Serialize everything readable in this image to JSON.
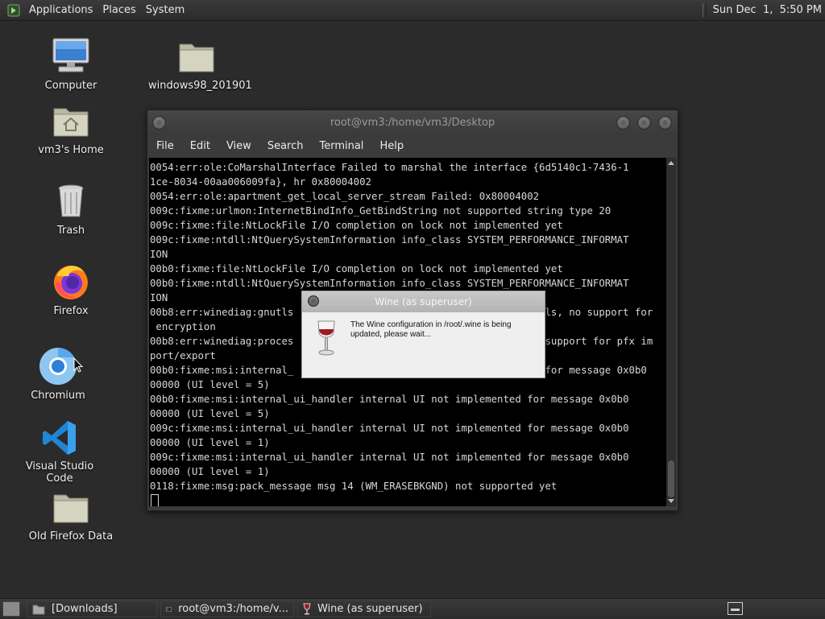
{
  "top_panel": {
    "menus": [
      "Applications",
      "Places",
      "System"
    ],
    "clock": "Sun Dec  1,  5:50 PM"
  },
  "desktop": {
    "icons": [
      {
        "label": "Computer",
        "icon": "computer-icon"
      },
      {
        "label": "windows98_201901",
        "icon": "folder-icon"
      },
      {
        "label": "vm3's Home",
        "icon": "home-folder-icon"
      },
      {
        "label": "Trash",
        "icon": "trash-icon"
      },
      {
        "label": "Firefox",
        "icon": "firefox-icon"
      },
      {
        "label": "Chromium",
        "icon": "chromium-icon"
      },
      {
        "label": "Visual Studio Code",
        "icon": "vscode-icon"
      },
      {
        "label": "Old Firefox Data",
        "icon": "folder-icon"
      }
    ]
  },
  "terminal": {
    "title": "root@vm3:/home/vm3/Desktop",
    "menu": [
      "File",
      "Edit",
      "View",
      "Search",
      "Terminal",
      "Help"
    ],
    "lines": [
      "0054:err:ole:CoMarshalInterface Failed to marshal the interface {6d5140c1-7436-1",
      "1ce-8034-00aa006009fa}, hr 0x80004002",
      "0054:err:ole:apartment_get_local_server_stream Failed: 0x80004002",
      "009c:fixme:urlmon:InternetBindInfo_GetBindString not supported string type 20",
      "009c:fixme:file:NtLockFile I/O completion on lock not implemented yet",
      "009c:fixme:ntdll:NtQuerySystemInformation info_class SYSTEM_PERFORMANCE_INFORMAT",
      "ION",
      "00b0:fixme:file:NtLockFile I/O completion on lock not implemented yet",
      "00b0:fixme:ntdll:NtQuerySystemInformation info_class SYSTEM_PERFORMANCE_INFORMAT",
      "ION",
      "00b8:err:winediag:gnutls                                         tls, no support for",
      " encryption",
      "00b8:err:winediag:proces                                          support for pfx im",
      "port/export",
      "00b0:fixme:msi:internal_                                        d for message 0x0b0",
      "00000 (UI level = 5)",
      "00b0:fixme:msi:internal_ui_handler internal UI not implemented for message 0x0b0",
      "00000 (UI level = 5)",
      "009c:fixme:msi:internal_ui_handler internal UI not implemented for message 0x0b0",
      "00000 (UI level = 1)",
      "009c:fixme:msi:internal_ui_handler internal UI not implemented for message 0x0b0",
      "00000 (UI level = 1)",
      "0118:fixme:msg:pack_message msg 14 (WM_ERASEBKGND) not supported yet"
    ]
  },
  "wine_dialog": {
    "title": "Wine (as superuser)",
    "message": "The Wine configuration in /root/.wine is being updated, please wait..."
  },
  "taskbar": {
    "items": [
      {
        "label": "[Downloads]",
        "icon": "folder-icon"
      },
      {
        "label": "root@vm3:/home/v...",
        "icon": "terminal-icon"
      },
      {
        "label": "Wine (as superuser)",
        "icon": "wine-glass-icon"
      }
    ]
  },
  "colors": {
    "desktop_bg": "#2b2b2b",
    "panel_bg": "#333333",
    "terminal_bg": "#000000",
    "terminal_fg": "#d8d8d8",
    "dialog_bg": "#efefef"
  }
}
